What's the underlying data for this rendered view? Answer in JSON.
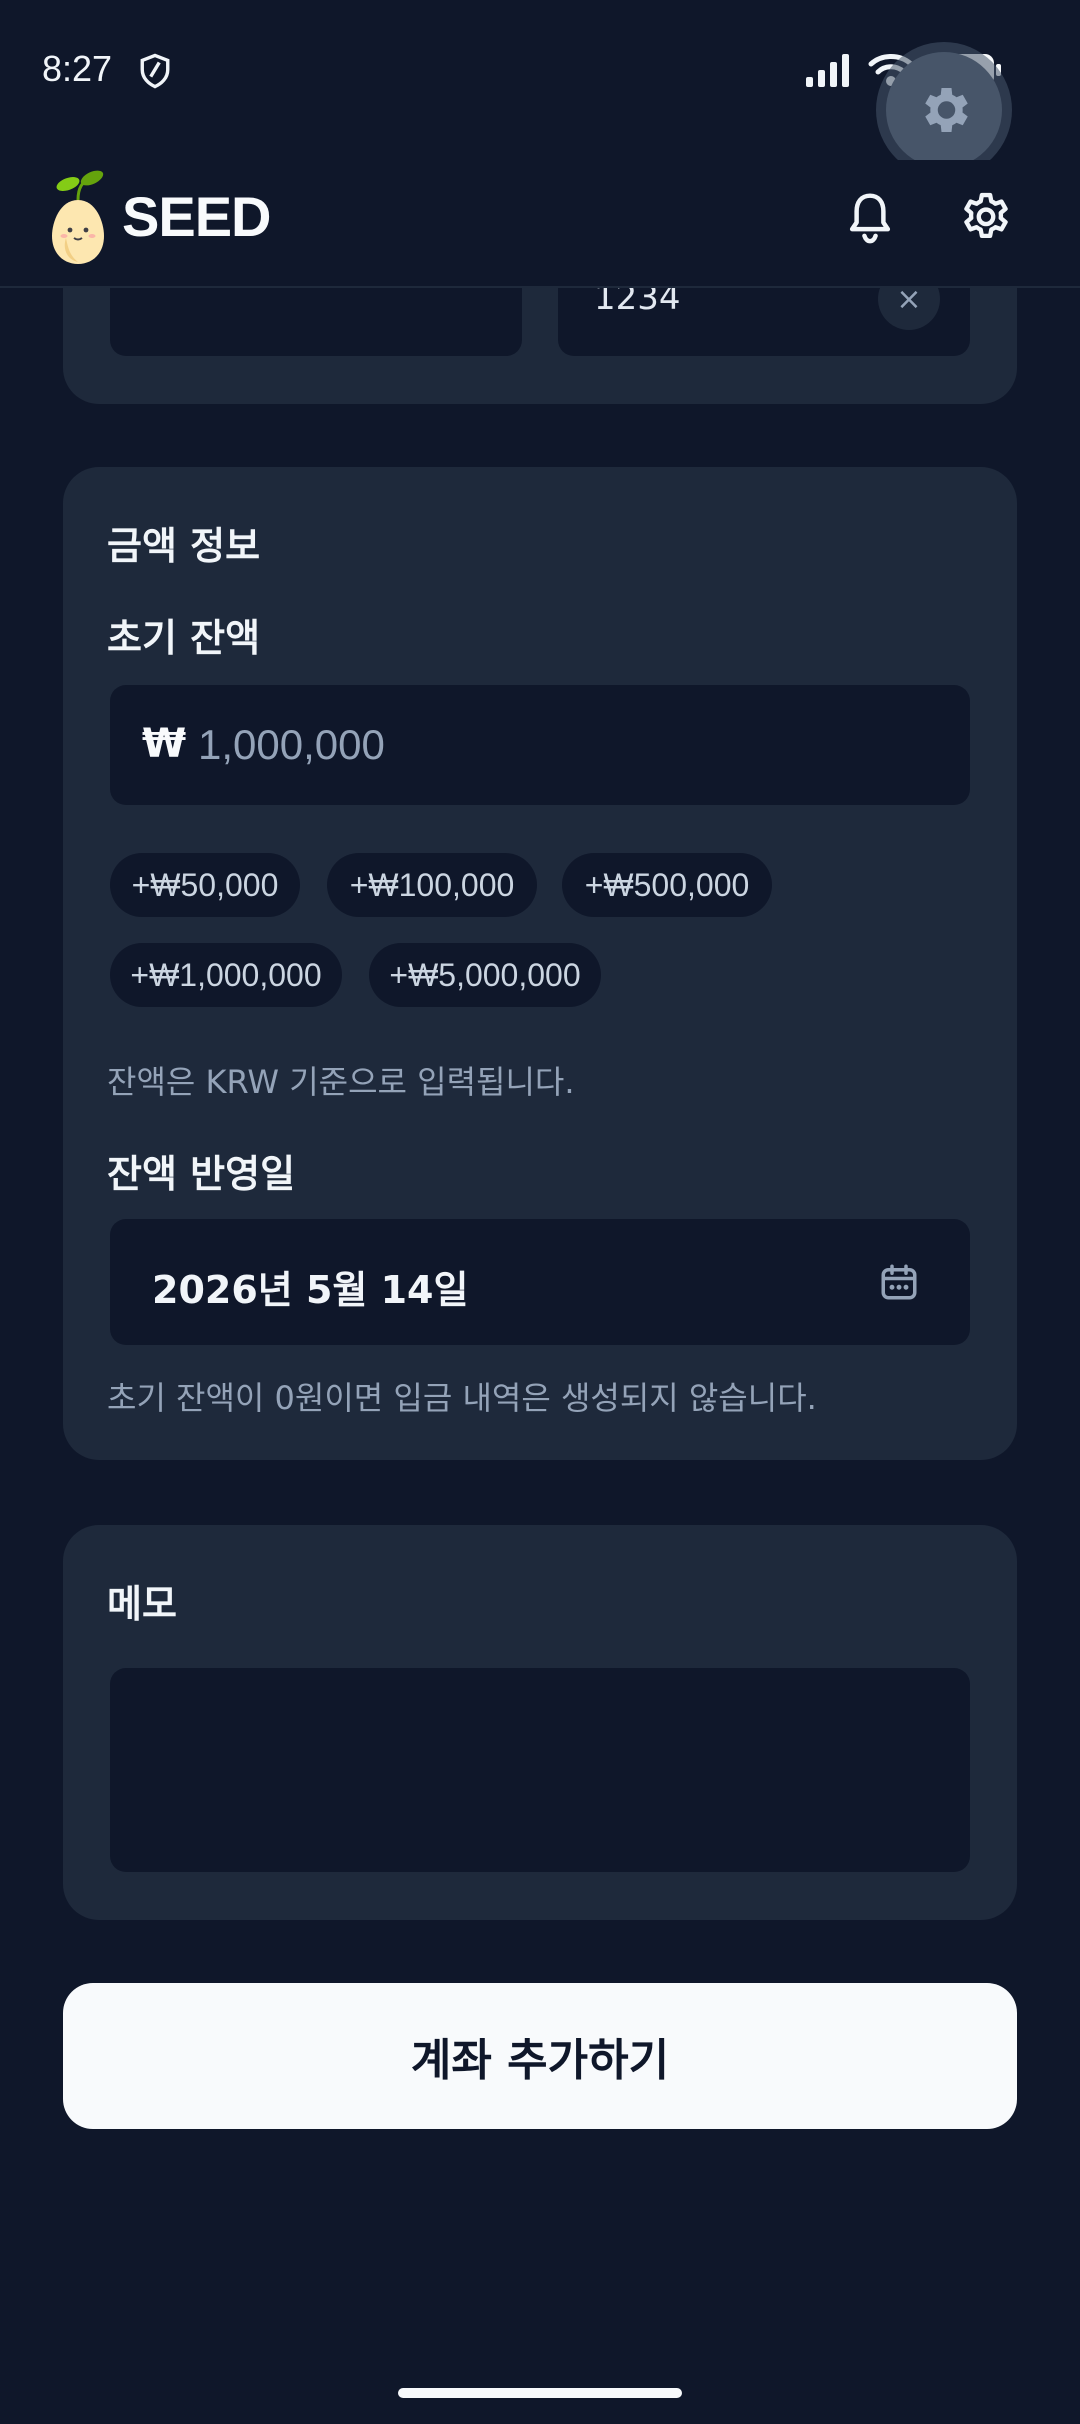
{
  "status_bar": {
    "time": "8:27"
  },
  "header": {
    "brand": "SEED"
  },
  "account_section": {
    "number_value": "1234",
    "clear_label": "×"
  },
  "amount_section": {
    "title": "금액 정보",
    "initial_balance_label": "초기 잔액",
    "currency_symbol": "₩",
    "amount_placeholder": "1,000,000",
    "chips": [
      "+₩50,000",
      "+₩100,000",
      "+₩500,000",
      "+₩1,000,000",
      "+₩5,000,000"
    ],
    "currency_hint": "잔액은 KRW 기준으로 입력됩니다.",
    "date_label": "잔액 반영일",
    "date_value": "2026년 5월 14일",
    "zero_hint": "초기 잔액이 0원이면 입금 내역은 생성되지 않습니다."
  },
  "memo_section": {
    "title": "메모"
  },
  "submit": {
    "label": "계좌 추가하기"
  },
  "colors": {
    "background": "#0f172a",
    "card": "#1e293b",
    "button": "#f8fafc"
  }
}
